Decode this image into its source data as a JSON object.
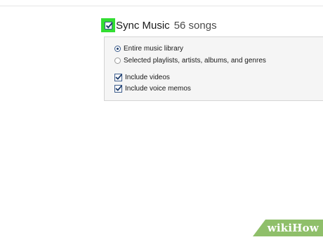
{
  "sync": {
    "title": "Sync Music",
    "count": "56 songs",
    "checked": true
  },
  "options": {
    "radios": [
      {
        "label": "Entire music library",
        "selected": true
      },
      {
        "label": "Selected playlists, artists, albums, and genres",
        "selected": false
      }
    ],
    "checkboxes": [
      {
        "label": "Include videos",
        "checked": true
      },
      {
        "label": "Include voice memos",
        "checked": true
      }
    ]
  },
  "watermark": {
    "text": "wikiHow"
  },
  "colors": {
    "highlight": "#33dd33",
    "panel_background": "#f5f5f5",
    "check_blue": "#1c3b6b",
    "watermark_green": "#8fbf6a"
  },
  "icons": {
    "checkbox": "checkbox-checked-icon",
    "radio_selected": "radio-selected-icon",
    "radio_unselected": "radio-unselected-icon"
  }
}
